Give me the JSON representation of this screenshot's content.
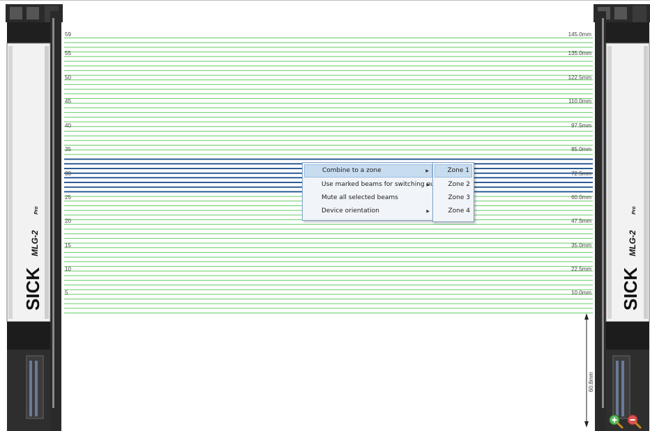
{
  "device": {
    "brand": "SICK",
    "model": "MLG-2",
    "model_suffix": "Pro"
  },
  "beams": {
    "left_labels": [
      "59",
      "55",
      "50",
      "45",
      "40",
      "35",
      "30",
      "25",
      "20",
      "15",
      "10",
      "5"
    ],
    "right_labels": [
      "145.0mm",
      "135.0mm",
      "122.5mm",
      "110.0mm",
      "97.5mm",
      "85.0mm",
      "72.5mm",
      "60.0mm",
      "47.5mm",
      "35.0mm",
      "22.5mm",
      "10.0mm"
    ],
    "selected_beams": [
      26,
      27,
      28,
      29,
      30,
      31,
      32,
      33
    ],
    "unselected_color": "#66cc66",
    "selected_color": "#2c5c96"
  },
  "dimension": {
    "label": "60.8mm"
  },
  "context_menu": {
    "items": [
      {
        "label": "Combine to a zone",
        "has_submenu": true,
        "highlighted": true
      },
      {
        "label": "Use marked beams for switching output",
        "has_submenu": true,
        "highlighted": false
      },
      {
        "label": "Mute all selected beams",
        "has_submenu": false,
        "highlighted": false
      },
      {
        "label": "Device orientation",
        "has_submenu": true,
        "highlighted": false
      }
    ],
    "arrow_glyph": "▶"
  },
  "submenu": {
    "items": [
      {
        "label": "Zone 1",
        "highlighted": true
      },
      {
        "label": "Zone 2",
        "highlighted": false
      },
      {
        "label": "Zone 3",
        "highlighted": false
      },
      {
        "label": "Zone 4",
        "highlighted": false
      }
    ]
  },
  "zoom": {
    "zoom_in_icon": "zoom-in",
    "zoom_out_icon": "zoom-out"
  },
  "colors": {
    "beam_green": "#66cc66",
    "beam_blue": "#2c5c96",
    "menu_bg": "#f1f4f8",
    "menu_highlight": "#c8dcf0"
  }
}
